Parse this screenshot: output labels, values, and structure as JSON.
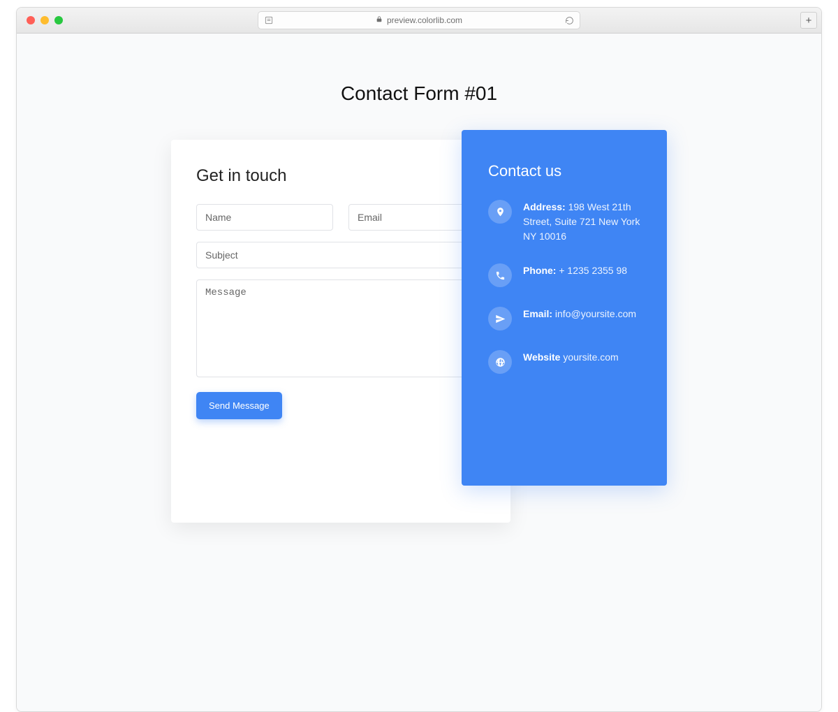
{
  "browser": {
    "url": "preview.colorlib.com"
  },
  "page": {
    "title": "Contact Form #01"
  },
  "form": {
    "heading": "Get in touch",
    "name_ph": "Name",
    "email_ph": "Email",
    "subject_ph": "Subject",
    "message_ph": "Message",
    "submit_label": "Send Message"
  },
  "contact": {
    "heading": "Contact us",
    "address_label": "Address:",
    "address_value": "198 West 21th Street, Suite 721 New York NY 10016",
    "phone_label": "Phone:",
    "phone_value": "+ 1235 2355 98",
    "email_label": "Email:",
    "email_value": "info@yoursite.com",
    "website_label": "Website",
    "website_value": "yoursite.com"
  }
}
